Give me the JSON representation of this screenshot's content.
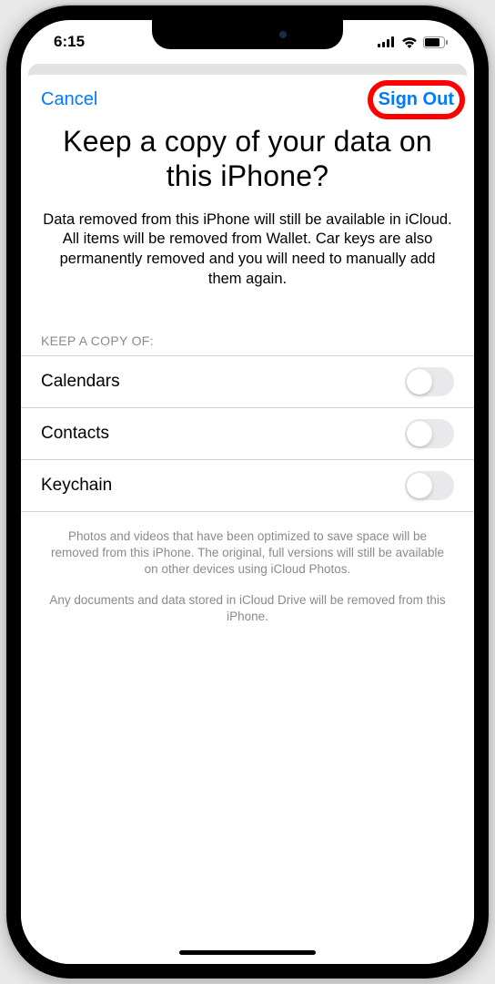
{
  "status": {
    "time": "6:15"
  },
  "nav": {
    "cancel_label": "Cancel",
    "signout_label": "Sign Out"
  },
  "title": "Keep a copy of your data on this iPhone?",
  "subtitle": "Data removed from this iPhone will still be available in iCloud. All items will be removed from Wallet. Car keys are also permanently removed and you will need to manually add them again.",
  "section_header": "KEEP A COPY OF:",
  "items": [
    {
      "label": "Calendars",
      "on": false
    },
    {
      "label": "Contacts",
      "on": false
    },
    {
      "label": "Keychain",
      "on": false
    }
  ],
  "footnote1": "Photos and videos that have been optimized to save space will be removed from this iPhone. The original, full versions will still be available on other devices using iCloud Photos.",
  "footnote2": "Any documents and data stored in iCloud Drive will be removed from this iPhone."
}
